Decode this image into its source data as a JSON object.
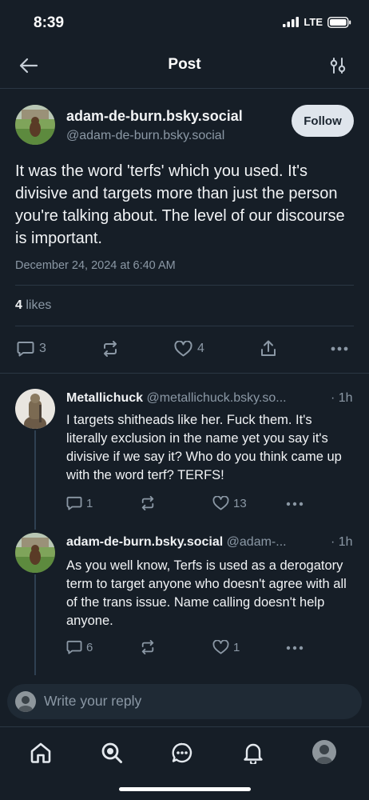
{
  "status_bar": {
    "time": "8:39",
    "network": "LTE"
  },
  "header": {
    "title": "Post"
  },
  "post": {
    "author_name": "adam-de-burn.bsky.social",
    "author_handle": "@adam-de-burn.bsky.social",
    "follow_label": "Follow",
    "text": "It was the word 'terfs' which you used. It's divisive and targets more than just the person you're talking about. The level of our discourse is important.",
    "date": "December 24, 2024 at 6:40 AM",
    "likes_count": "4",
    "likes_label": "likes",
    "reply_count": "3",
    "like_count": "4"
  },
  "replies": [
    {
      "name": "Metallichuck",
      "handle": "@metallichuck.bsky.so...",
      "time": "· 1h",
      "text": "I targets shitheads like her. Fuck them. It's literally exclusion in the name yet you say it's divisive if we say it? Who do you think came up with the word terf? TERFS!",
      "reply_count": "1",
      "like_count": "13"
    },
    {
      "name": "adam-de-burn.bsky.social",
      "handle": "@adam-...",
      "time": "· 1h",
      "text": "As you well know, Terfs is used as a derogatory term to target anyone who doesn't agree with all of the trans issue. Name calling doesn't help anyone.",
      "reply_count": "6",
      "like_count": "1"
    }
  ],
  "composer": {
    "placeholder": "Write your reply"
  },
  "colors": {
    "background": "#161e27",
    "muted": "#8b98a5",
    "follow_bg": "#dfe5ec"
  },
  "icons": [
    "back-arrow-icon",
    "filter-sliders-icon",
    "reply-icon",
    "repost-icon",
    "heart-icon",
    "share-icon",
    "more-icon",
    "home-icon",
    "search-icon",
    "chat-icon",
    "bell-icon"
  ]
}
